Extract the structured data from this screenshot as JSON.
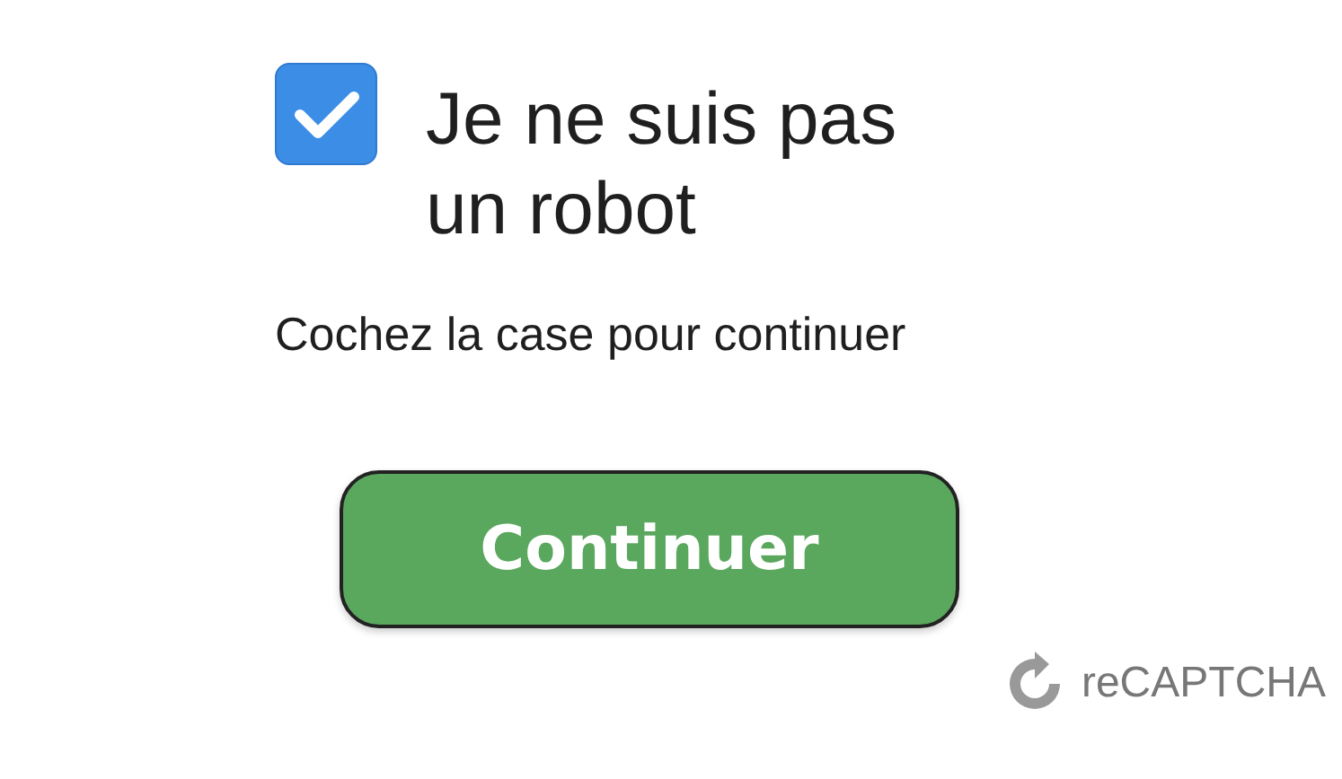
{
  "checkbox": {
    "label": "Je ne suis pas un robot",
    "checked": true
  },
  "instruction": "Cochez la case pour continuer",
  "button": {
    "label": "Continuer"
  },
  "branding": {
    "text": "reCAPTCHA"
  }
}
